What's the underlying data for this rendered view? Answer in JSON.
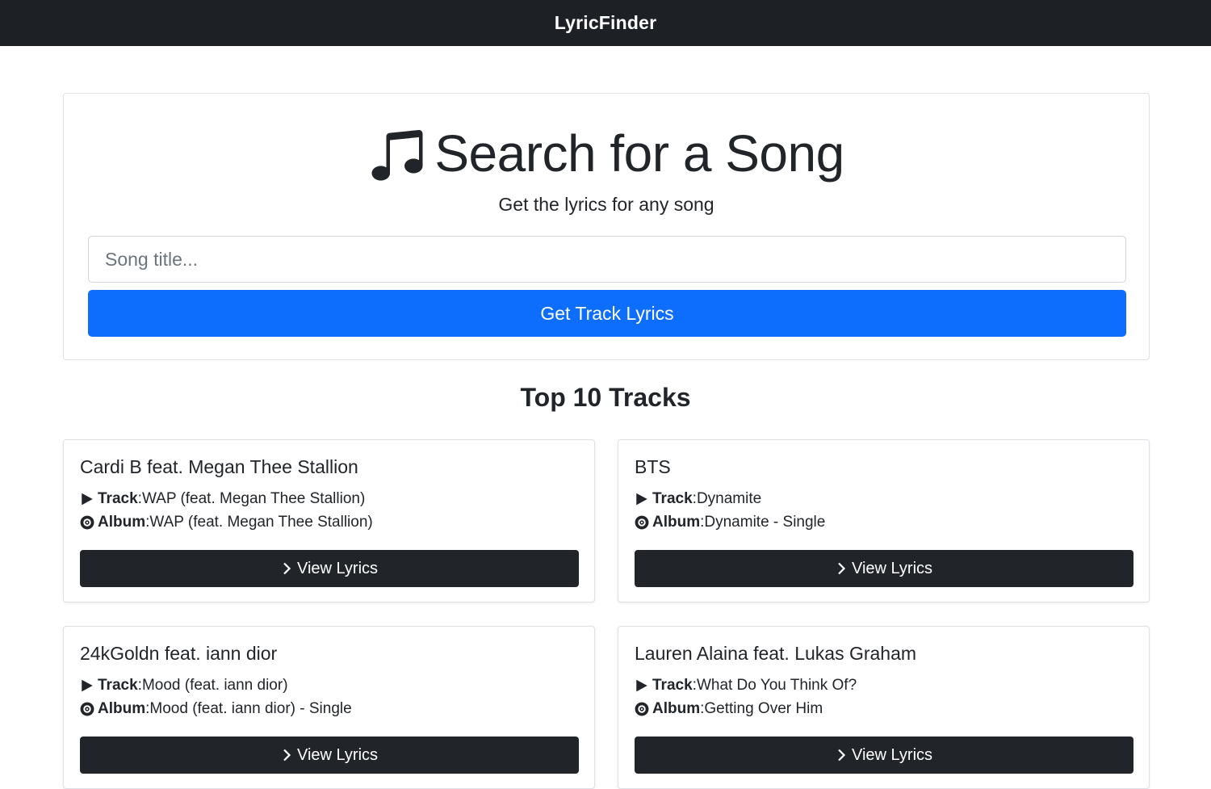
{
  "navbar": {
    "brand": "LyricFinder"
  },
  "search": {
    "icon": "music-note-icon",
    "heading": "Search for a Song",
    "subheading": "Get the lyrics for any song",
    "input_placeholder": "Song title...",
    "input_value": "",
    "button_label": "Get Track Lyrics",
    "button_color": "#0d6efd"
  },
  "tracks_section": {
    "title": "Top 10 Tracks",
    "track_label": "Track",
    "album_label": "Album",
    "button_label": "View Lyrics",
    "items": [
      {
        "artist": "Cardi B feat. Megan Thee Stallion",
        "track": "WAP (feat. Megan Thee Stallion)",
        "album": "WAP (feat. Megan Thee Stallion)"
      },
      {
        "artist": "BTS",
        "track": "Dynamite",
        "album": "Dynamite - Single"
      },
      {
        "artist": "24kGoldn feat. iann dior",
        "track": "Mood (feat. iann dior)",
        "album": "Mood (feat. iann dior) - Single"
      },
      {
        "artist": "Lauren Alaina feat. Lukas Graham",
        "track": "What Do You Think Of?",
        "album": "Getting Over Him"
      }
    ]
  }
}
